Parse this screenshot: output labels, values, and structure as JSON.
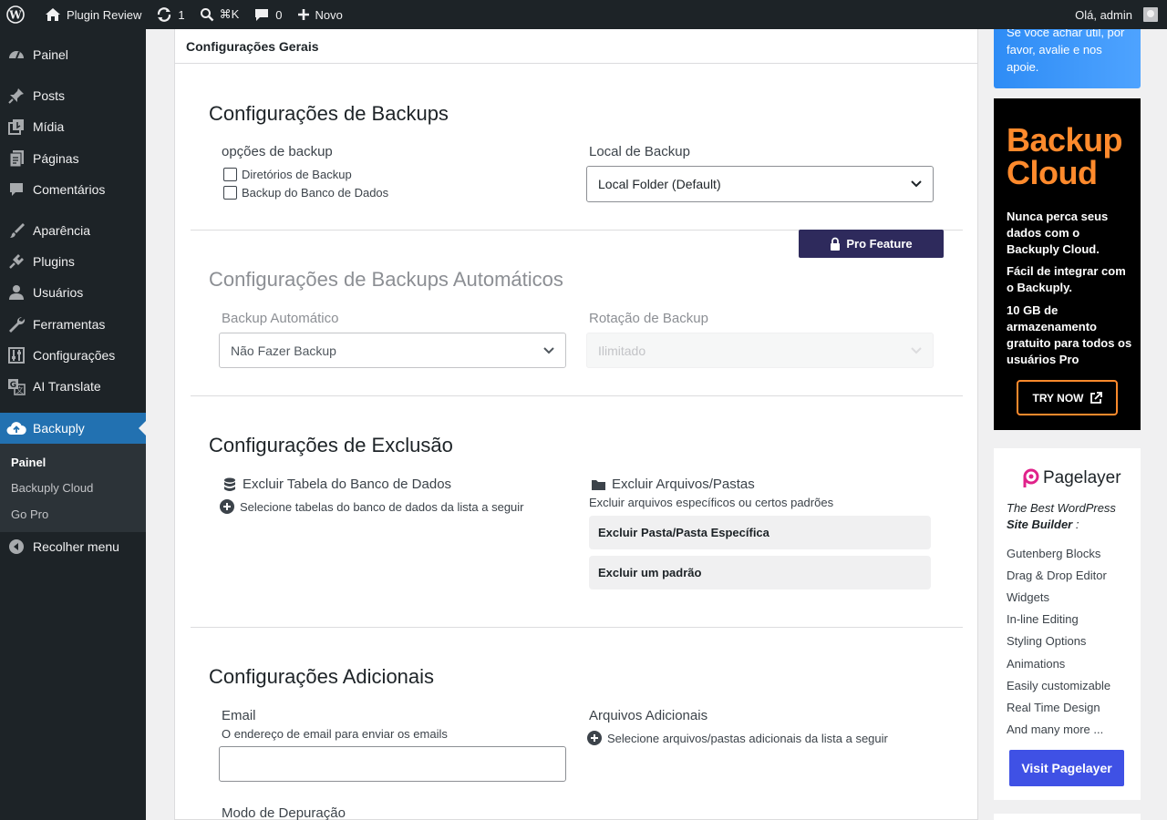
{
  "adminbar": {
    "site_name": "Plugin Review",
    "updates_count": "1",
    "search_shortcut": "⌘K",
    "comments_count": "0",
    "new_label": "Novo",
    "greeting": "Olá, admin"
  },
  "sidebar": {
    "items": [
      {
        "label": "Painel",
        "icon": "dashboard-icon"
      },
      {
        "label": "Posts",
        "icon": "pin-icon"
      },
      {
        "label": "Mídia",
        "icon": "media-icon"
      },
      {
        "label": "Páginas",
        "icon": "pages-icon"
      },
      {
        "label": "Comentários",
        "icon": "comments-icon"
      },
      {
        "label": "Aparência",
        "icon": "brush-icon"
      },
      {
        "label": "Plugins",
        "icon": "plugin-icon"
      },
      {
        "label": "Usuários",
        "icon": "user-icon"
      },
      {
        "label": "Ferramentas",
        "icon": "wrench-icon"
      },
      {
        "label": "Configurações",
        "icon": "settings-icon"
      },
      {
        "label": "AI Translate",
        "icon": "translate-icon"
      },
      {
        "label": "Backuply",
        "icon": "cloud-upload-icon"
      }
    ],
    "submenu": [
      "Painel",
      "Backuply Cloud",
      "Go Pro"
    ],
    "collapse_label": "Recolher menu"
  },
  "panel": {
    "header": "Configurações Gerais",
    "backups": {
      "title": "Configurações de Backups",
      "options_label": "opções de backup",
      "opt_dirs": "Diretórios de Backup",
      "opt_db": "Backup do Banco de Dados",
      "location_label": "Local de Backup",
      "location_value": "Local Folder (Default)"
    },
    "auto": {
      "pro_badge": "Pro Feature",
      "title": "Configurações de Backups Automáticos",
      "auto_label": "Backup Automático",
      "auto_value": "Não Fazer Backup",
      "rotation_label": "Rotação de Backup",
      "rotation_value": "Ilimitado"
    },
    "exclusion": {
      "title": "Configurações de Exclusão",
      "db_label": "Excluir Tabela do Banco de Dados",
      "db_action": "Selecione tabelas do banco de dados da lista a seguir",
      "files_label": "Excluir Arquivos/Pastas",
      "files_desc": "Excluir arquivos específicos ou certos padrões",
      "btn_folder": "Excluir Pasta/Pasta Específica",
      "btn_pattern": "Excluir um padrão"
    },
    "additional": {
      "title": "Configurações Adicionais",
      "email_label": "Email",
      "email_desc": "O endereço de email para enviar os emails",
      "email_value": "",
      "files_label": "Arquivos Adicionais",
      "files_action": "Selecione arquivos/pastas adicionais da lista a seguir",
      "debug_label": "Modo de Depuração"
    }
  },
  "widgets": {
    "rating_text": "Se você achar útil, por favor, avalie e nos apoie.",
    "cloud": {
      "title_line1": "Backup",
      "title_line2": "Cloud",
      "p1": "Nunca perca seus dados com o Backuply Cloud.",
      "p2": "Fácil de integrar com o Backuply.",
      "p3": "10 GB de armazenamento gratuito para todos os usuários Pro",
      "button": "TRY NOW"
    },
    "pagelayer": {
      "logo_text": "Pagelayer",
      "tagline": "The Best WordPress",
      "tagline_bold": "Site Builder",
      "tagline_end": " :",
      "features": [
        "Gutenberg Blocks",
        "Drag & Drop Editor",
        "Widgets",
        "In-line Editing",
        "Styling Options",
        "Animations",
        "Easily customizable",
        "Real Time Design",
        "And many more ..."
      ],
      "button": "Visit Pagelayer"
    }
  },
  "colors": {
    "accent": "#2271b1",
    "pro_badge": "#2e2a5c",
    "cloud_orange": "#ff8a2c",
    "pagelayer_button": "#3f51e5"
  }
}
